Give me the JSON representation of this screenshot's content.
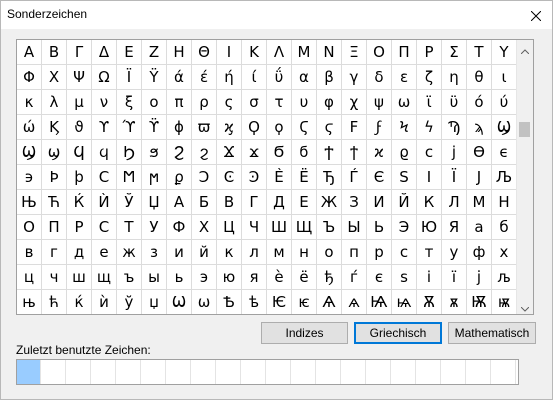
{
  "window": {
    "title": "Sonderzeichen",
    "close_icon": "close-icon"
  },
  "grid": {
    "rows": [
      [
        "Α",
        "Β",
        "Γ",
        "Δ",
        "Ε",
        "Ζ",
        "Η",
        "Θ",
        "Ι",
        "Κ",
        "Λ",
        "Μ",
        "Ν",
        "Ξ",
        "Ο",
        "Π",
        "Ρ",
        "Σ",
        "Τ",
        "Υ"
      ],
      [
        "Φ",
        "Χ",
        "Ψ",
        "Ω",
        "Ϊ",
        "Ϋ",
        "ά",
        "έ",
        "ή",
        "ί",
        "ΰ",
        "α",
        "β",
        "γ",
        "δ",
        "ε",
        "ζ",
        "η",
        "θ",
        "ι"
      ],
      [
        "κ",
        "λ",
        "μ",
        "ν",
        "ξ",
        "ο",
        "π",
        "ρ",
        "ς",
        "σ",
        "τ",
        "υ",
        "φ",
        "χ",
        "ψ",
        "ω",
        "ϊ",
        "ϋ",
        "ό",
        "ύ"
      ],
      [
        "ώ",
        "Ϗ",
        "ϑ",
        "ϒ",
        "ϓ",
        "ϔ",
        "ϕ",
        "ϖ",
        "ϗ",
        "Ϙ",
        "ϙ",
        "Ϛ",
        "ϛ",
        "Ϝ",
        "ϝ",
        "Ϟ",
        "ϟ",
        "Ϡ",
        "ϡ",
        "Ϣ"
      ],
      [
        "Ϣ",
        "ϣ",
        "Ϥ",
        "ϥ",
        "Ϧ",
        "ϧ",
        "Ϩ",
        "ϩ",
        "Ϫ",
        "ϫ",
        "Ϭ",
        "ϭ",
        "Ϯ",
        "ϯ",
        "ϰ",
        "ϱ",
        "ϲ",
        "ϳ",
        "ϴ",
        "ϵ"
      ],
      [
        "϶",
        "Ϸ",
        "ϸ",
        "Ϲ",
        "Ϻ",
        "ϻ",
        "ϼ",
        "Ͻ",
        "Ͼ",
        "Ͽ",
        "Ѐ",
        "Ё",
        "Ђ",
        "Ѓ",
        "Є",
        "Ѕ",
        "І",
        "Ї",
        "Ј",
        "Љ"
      ],
      [
        "Њ",
        "Ћ",
        "Ќ",
        "Ѝ",
        "Ў",
        "Џ",
        "А",
        "Б",
        "В",
        "Г",
        "Д",
        "Е",
        "Ж",
        "З",
        "И",
        "Й",
        "К",
        "Л",
        "М",
        "Н"
      ],
      [
        "О",
        "П",
        "Р",
        "С",
        "Т",
        "У",
        "Ф",
        "Х",
        "Ц",
        "Ч",
        "Ш",
        "Щ",
        "Ъ",
        "Ы",
        "Ь",
        "Э",
        "Ю",
        "Я",
        "а",
        "б"
      ],
      [
        "в",
        "г",
        "д",
        "е",
        "ж",
        "з",
        "и",
        "й",
        "к",
        "л",
        "м",
        "н",
        "о",
        "п",
        "р",
        "с",
        "т",
        "у",
        "ф",
        "х"
      ],
      [
        "ц",
        "ч",
        "ш",
        "щ",
        "ъ",
        "ы",
        "ь",
        "э",
        "ю",
        "я",
        "ѐ",
        "ё",
        "ђ",
        "ѓ",
        "є",
        "ѕ",
        "і",
        "ї",
        "ј",
        "љ"
      ],
      [
        "њ",
        "ћ",
        "ќ",
        "ѝ",
        "ў",
        "џ",
        "Ѡ",
        "ѡ",
        "Ѣ",
        "ѣ",
        "Ѥ",
        "ѥ",
        "Ѧ",
        "ѧ",
        "Ѩ",
        "ѩ",
        "Ѫ",
        "ѫ",
        "Ѭ",
        "ѭ"
      ]
    ]
  },
  "scrollbar": {
    "up_icon": "scroll-up-arrow-icon",
    "down_icon": "scroll-down-arrow-icon"
  },
  "buttons": {
    "indizes": "Indizes",
    "griechisch": "Griechisch",
    "mathematisch": "Mathematisch"
  },
  "recent": {
    "label": "Zuletzt benutzte Zeichen:",
    "slots": 20,
    "selected_index": 0
  },
  "colors": {
    "selection": "#99ccff",
    "default_button_border": "#0078d7"
  }
}
